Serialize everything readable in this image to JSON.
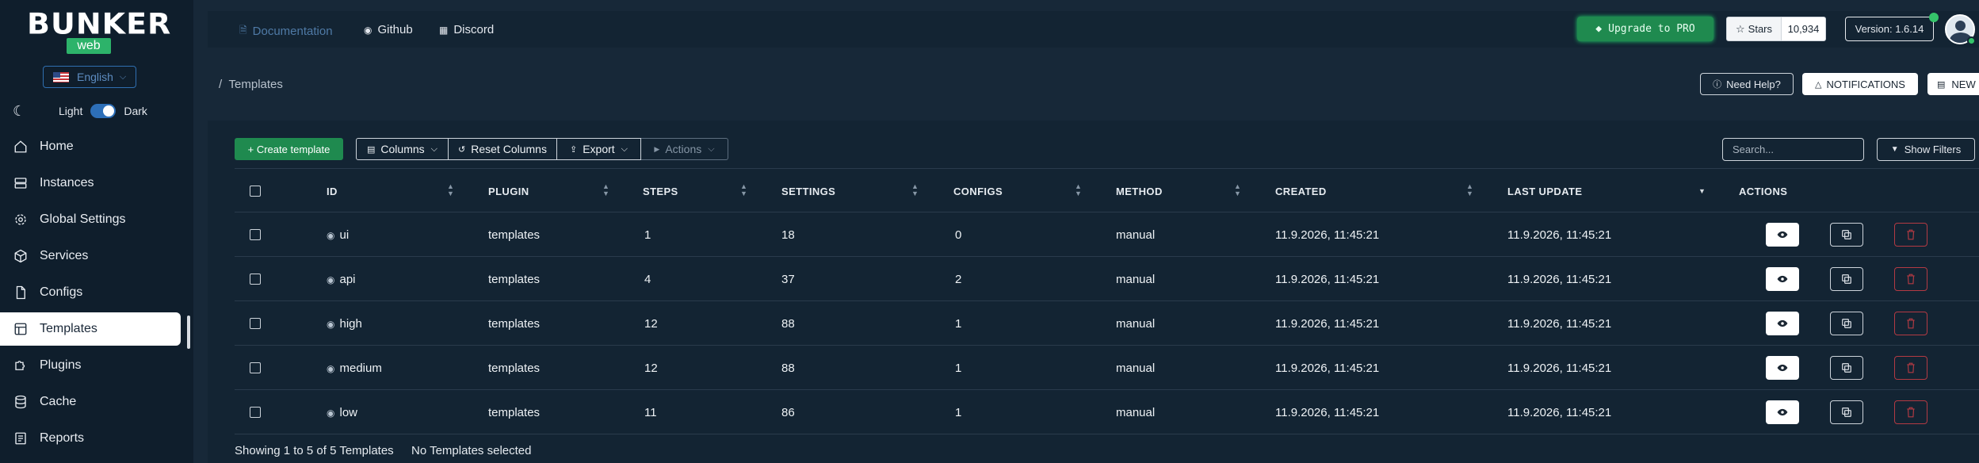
{
  "brand": {
    "logo_text": "BUNKER",
    "logo_sub": "web"
  },
  "sidebar": {
    "language": "English",
    "theme": {
      "light": "Light",
      "dark": "Dark"
    },
    "items": [
      {
        "label": "Home",
        "icon": "home-icon"
      },
      {
        "label": "Instances",
        "icon": "server-icon"
      },
      {
        "label": "Global Settings",
        "icon": "gear-icon"
      },
      {
        "label": "Services",
        "icon": "cube-icon"
      },
      {
        "label": "Configs",
        "icon": "file-icon"
      },
      {
        "label": "Templates",
        "icon": "layout-icon",
        "active": true
      },
      {
        "label": "Plugins",
        "icon": "puzzle-icon"
      },
      {
        "label": "Cache",
        "icon": "database-icon"
      },
      {
        "label": "Reports",
        "icon": "report-icon"
      }
    ]
  },
  "topbar": {
    "documentation": "Documentation",
    "github": "Github",
    "discord": "Discord",
    "upgrade": "Upgrade to PRO",
    "stars_label": "Stars",
    "stars_count": "10,934",
    "version": "Version: 1.6.14"
  },
  "breadcrumb": {
    "separator": "/",
    "current": "Templates"
  },
  "header_actions": {
    "help": "Need Help?",
    "notifications": "NOTIFICATIONS",
    "news": "NEW"
  },
  "toolbar": {
    "create": "+ Create template",
    "columns": "Columns",
    "reset_columns": "Reset Columns",
    "export": "Export",
    "actions": "Actions",
    "search_placeholder": "Search...",
    "show_filters": "Show Filters"
  },
  "table": {
    "columns": [
      "ID",
      "PLUGIN",
      "STEPS",
      "SETTINGS",
      "CONFIGS",
      "METHOD",
      "CREATED",
      "LAST UPDATE",
      "ACTIONS"
    ],
    "rows": [
      {
        "id": "ui",
        "plugin": "templates",
        "steps": "1",
        "settings": "18",
        "configs": "0",
        "method": "manual",
        "created": "11.9.2026, 11:45:21",
        "last_update": "11.9.2026, 11:45:21"
      },
      {
        "id": "api",
        "plugin": "templates",
        "steps": "4",
        "settings": "37",
        "configs": "2",
        "method": "manual",
        "created": "11.9.2026, 11:45:21",
        "last_update": "11.9.2026, 11:45:21"
      },
      {
        "id": "high",
        "plugin": "templates",
        "steps": "12",
        "settings": "88",
        "configs": "1",
        "method": "manual",
        "created": "11.9.2026, 11:45:21",
        "last_update": "11.9.2026, 11:45:21"
      },
      {
        "id": "medium",
        "plugin": "templates",
        "steps": "12",
        "settings": "88",
        "configs": "1",
        "method": "manual",
        "created": "11.9.2026, 11:45:21",
        "last_update": "11.9.2026, 11:45:21"
      },
      {
        "id": "low",
        "plugin": "templates",
        "steps": "11",
        "settings": "86",
        "configs": "1",
        "method": "manual",
        "created": "11.9.2026, 11:45:21",
        "last_update": "11.9.2026, 11:45:21"
      }
    ]
  },
  "footer": {
    "showing": "Showing 1 to 5 of 5 Templates",
    "selected": "No Templates selected"
  },
  "colors": {
    "accent_green": "#1f8a4f",
    "danger": "#b33a43",
    "link_blue": "#5d8cc0"
  }
}
